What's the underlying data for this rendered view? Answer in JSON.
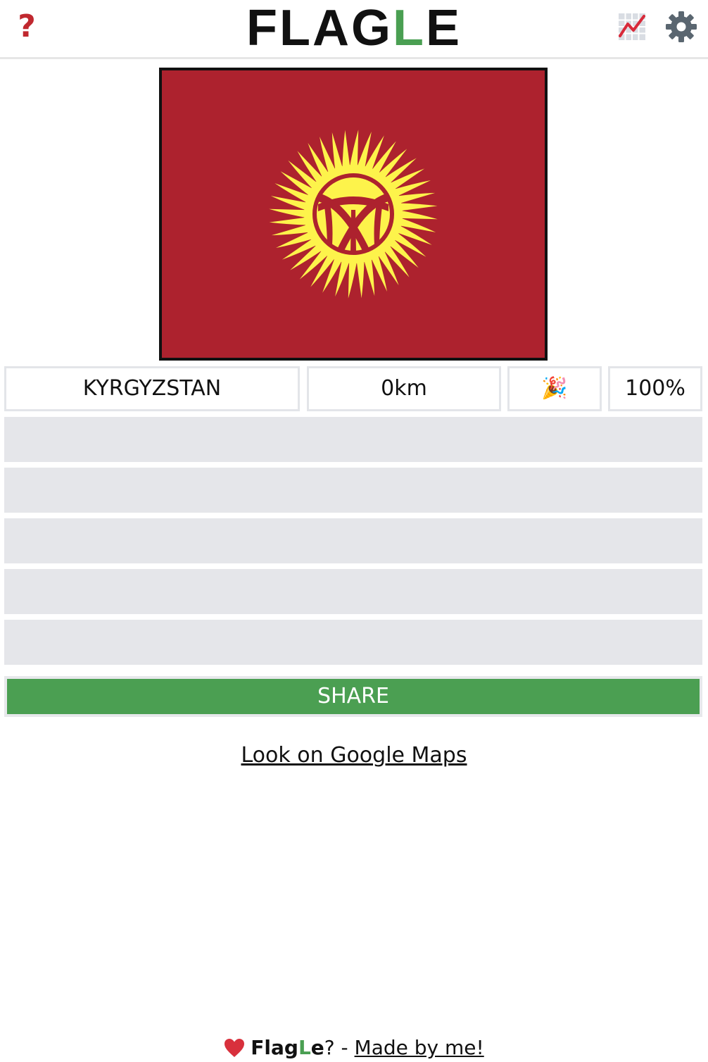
{
  "header": {
    "help_label": "?",
    "title_prefix": "FLAG",
    "title_accent": "L",
    "title_suffix": "E",
    "stats_icon": "stats-chart-icon",
    "settings_icon": "gear-icon"
  },
  "colors": {
    "accent_green": "#4a9f52",
    "flag_red": "#ad222e",
    "flag_yellow": "#fdf34b",
    "help_red": "#c0282f",
    "empty_row": "#e5e6ea"
  },
  "flag": {
    "country": "Kyrgyzstan",
    "description_icon": "kyrgyzstan-flag"
  },
  "guesses": [
    {
      "country": "KYRGYZSTAN",
      "distance": "0km",
      "direction_icon": "party-popper-icon",
      "direction_glyph": "🎉",
      "proximity": "100%"
    }
  ],
  "empty_rows": 5,
  "share": {
    "label": "SHARE"
  },
  "maps_link": {
    "label": "Look on Google Maps"
  },
  "footer": {
    "heart_icon": "heart-icon",
    "brand_prefix": "Flag",
    "brand_accent": "L",
    "brand_suffix": "e",
    "question": "? - ",
    "link_label": "Made by me!"
  }
}
